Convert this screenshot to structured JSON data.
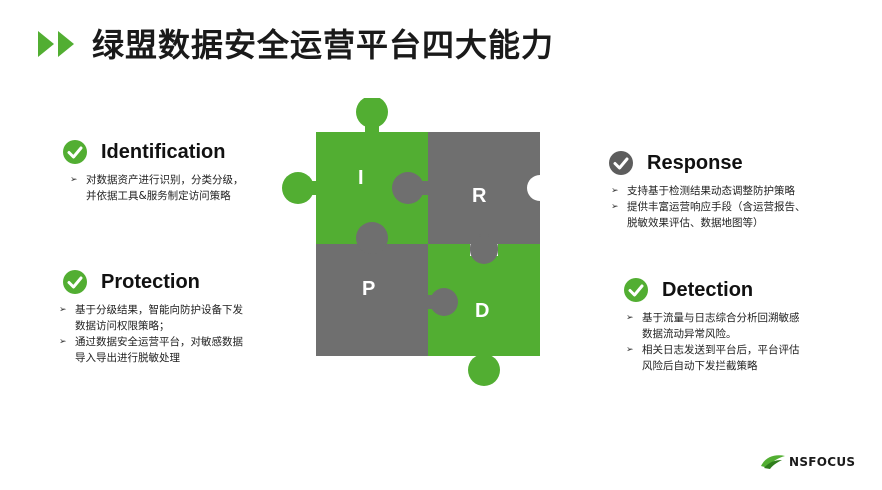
{
  "title": "绿盟数据安全运营平台四大能力",
  "colors": {
    "accent": "#52ae32",
    "gray": "#6f6f6f"
  },
  "puzzle": {
    "letters": {
      "i": "I",
      "r": "R",
      "p": "P",
      "d": "D"
    }
  },
  "sections": {
    "identification": {
      "title": "Identification",
      "bullets": [
        "对数据资产进行识别，分类分级，\n并依据工具&服务制定访问策略"
      ]
    },
    "protection": {
      "title": "Protection",
      "bullets": [
        "基于分级结果，智能向防护设备下发\n数据访问权限策略；",
        "通过数据安全运营平台，对敏感数据\n导入导出进行脱敏处理"
      ]
    },
    "response": {
      "title": "Response",
      "bullets": [
        "支持基于检测结果动态调整防护策略",
        "提供丰富运营响应手段（含运营报告、\n脱敏效果评估、数据地图等）"
      ]
    },
    "detection": {
      "title": "Detection",
      "bullets": [
        "基于流量与日志综合分析回溯敏感\n数据流动异常风险。",
        "相关日志发送到平台后，平台评估\n风险后自动下发拦截策略"
      ]
    }
  },
  "bullet_glyph": "➢",
  "logo": {
    "text": "NSFOCUS",
    "icon": "nsfocus-leaf-icon"
  }
}
